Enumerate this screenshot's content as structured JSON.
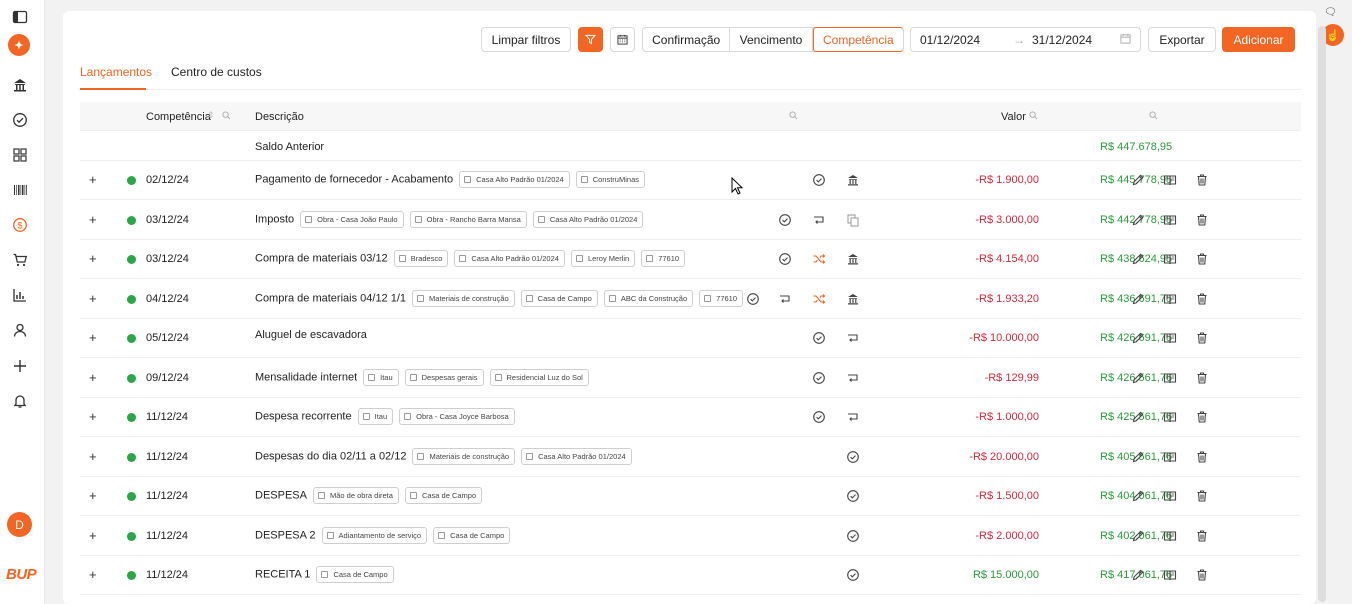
{
  "sidebar": {
    "items": [
      "panel-toggle-icon",
      "rocket-icon",
      "bank-icon",
      "check-circle-icon",
      "grid-icon",
      "barcode-icon",
      "money-icon",
      "cart-icon",
      "chart-icon",
      "user-icon",
      "plus-icon",
      "bell-icon"
    ],
    "avatar": "D",
    "brand": "BUP"
  },
  "toolbar": {
    "clear_filters": "Limpar filtros",
    "date_modes": [
      "Confirmação",
      "Vencimento",
      "Competência"
    ],
    "active_mode": "Competência",
    "date_start": "01/12/2024",
    "date_end": "31/12/2024",
    "export": "Exportar",
    "add": "Adicionar"
  },
  "tabs": [
    "Lançamentos",
    "Centro de custos"
  ],
  "table": {
    "headers": {
      "competencia": "Competência",
      "descricao": "Descrição",
      "valor": "Valor"
    },
    "saldo_label": "Saldo Anterior",
    "saldo_value": "R$ 447.678,95",
    "rows": [
      {
        "date": "02/12/24",
        "desc": "Pagamento de fornecedor - Acabamento",
        "tags": [
          "Casa Alto Padrão 01/2024",
          "ConstruMinas"
        ],
        "value": "-R$ 1.900,00",
        "balance": "R$ 445.778,95"
      },
      {
        "date": "03/12/24",
        "desc": "Imposto",
        "tags": [
          "Obra - Casa João Paulo",
          "Obra - Rancho Barra Mansa",
          "Casa Alto Padrão 01/2024"
        ],
        "value": "-R$ 3.000,00",
        "balance": "R$ 442.778,95"
      },
      {
        "date": "03/12/24",
        "desc": "Compra de materiais 03/12",
        "tags": [
          "Bradesco",
          "Casa Alto Padrão 01/2024",
          "Leroy Merlin",
          "77610"
        ],
        "value": "-R$ 4.154,00",
        "balance": "R$ 438.624,95"
      },
      {
        "date": "04/12/24",
        "desc": "Compra de materiais 04/12 1/1",
        "tags": [
          "Materiais de construção",
          "Casa de Campo",
          "ABC da Construção",
          "77610"
        ],
        "value": "-R$ 1.933,20",
        "balance": "R$ 436.691,75"
      },
      {
        "date": "05/12/24",
        "desc": "Aluguel de escavadora",
        "tags": [],
        "value": "-R$ 10.000,00",
        "balance": "R$ 426.691,75"
      },
      {
        "date": "09/12/24",
        "desc": "Mensalidade internet",
        "tags": [
          "Itau",
          "Despesas gerais",
          "Residencial Luz do Sol"
        ],
        "value": "-R$ 129,99",
        "balance": "R$ 426.561,76"
      },
      {
        "date": "11/12/24",
        "desc": "Despesa recorrente",
        "tags": [
          "Itau",
          "Obra - Casa Joyce Barbosa"
        ],
        "value": "-R$ 1.000,00",
        "balance": "R$ 425.561,76"
      },
      {
        "date": "11/12/24",
        "desc": "Despesas do dia 02/11 a 02/12",
        "tags": [
          "Materiais de construção",
          "Casa Alto Padrão 01/2024"
        ],
        "value": "-R$ 20.000,00",
        "balance": "R$ 405.561,76"
      },
      {
        "date": "11/12/24",
        "desc": "DESPESA",
        "tags": [
          "Mão de obra direta",
          "Casa de Campo"
        ],
        "value": "-R$ 1.500,00",
        "balance": "R$ 404.061,76"
      },
      {
        "date": "11/12/24",
        "desc": "DESPESA 2",
        "tags": [
          "Adiantamento de serviço",
          "Casa de Campo"
        ],
        "value": "-R$ 2.000,00",
        "balance": "R$ 402.061,76"
      },
      {
        "date": "11/12/24",
        "desc": "RECEITA 1",
        "tags": [
          "Casa de Campo"
        ],
        "value": "R$ 15.000,00",
        "balance": "R$ 417.061,76"
      }
    ]
  },
  "colors": {
    "accent": "#f26522",
    "negative": "#d9283a",
    "positive": "#2b9a3d",
    "status": "#27a844"
  }
}
